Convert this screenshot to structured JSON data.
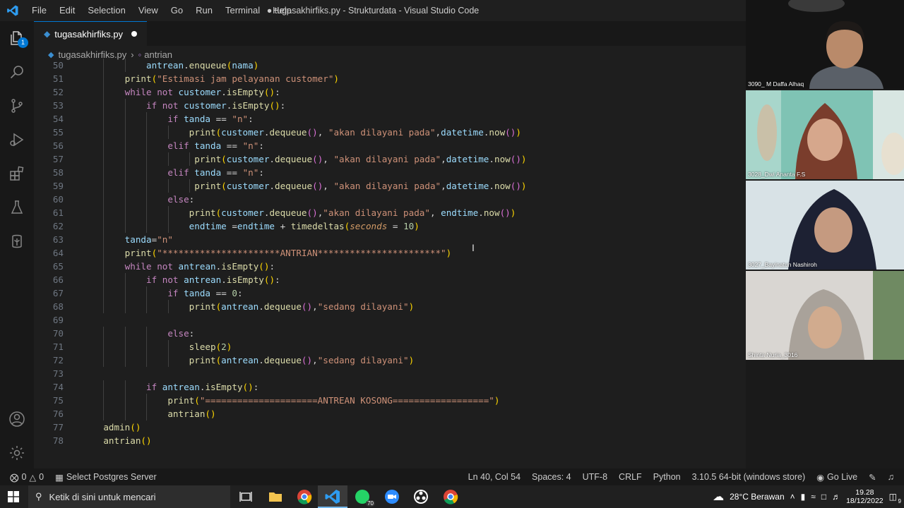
{
  "titlebar": {
    "menu": [
      "File",
      "Edit",
      "Selection",
      "View",
      "Go",
      "Run",
      "Terminal",
      "Help"
    ],
    "window_title": "● tugasakhirfiks.py - Strukturdata - Visual Studio Code"
  },
  "activity": {
    "icons": [
      "explorer-icon",
      "search-icon",
      "source-control-icon",
      "run-debug-icon",
      "extensions-icon",
      "testing-icon",
      "database-icon",
      "account-icon",
      "settings-gear-icon"
    ],
    "explorer_badge": "1"
  },
  "editor": {
    "tab_label": "tugasakhirfiks.py",
    "breadcrumb": {
      "file": "tugasakhirfiks.py",
      "symbol": "antrian"
    },
    "lines": [
      {
        "n": "50",
        "t": "            antrean.enqueue(nama)"
      },
      {
        "n": "51",
        "t": "        print(\"Estimasi jam pelayanan customer\")"
      },
      {
        "n": "52",
        "t": "        while not customer.isEmpty():"
      },
      {
        "n": "53",
        "t": "            if not customer.isEmpty():"
      },
      {
        "n": "54",
        "t": "                if tanda == \"n\":"
      },
      {
        "n": "55",
        "t": "                    print(customer.dequeue(), \"akan dilayani pada\",datetime.now())"
      },
      {
        "n": "56",
        "t": "                elif tanda == \"n\":"
      },
      {
        "n": "57",
        "t": "                     print(customer.dequeue(), \"akan dilayani pada\",datetime.now())"
      },
      {
        "n": "58",
        "t": "                elif tanda == \"n\":"
      },
      {
        "n": "59",
        "t": "                     print(customer.dequeue(), \"akan dilayani pada\",datetime.now())"
      },
      {
        "n": "60",
        "t": "                else:"
      },
      {
        "n": "61",
        "t": "                    print(customer.dequeue(),\"akan dilayani pada\", endtime.now())"
      },
      {
        "n": "62",
        "t": "                    endtime =endtime + timedeltas(seconds = 10)"
      },
      {
        "n": "63",
        "t": "        tanda=\"n\""
      },
      {
        "n": "64",
        "t": "        print(\"**********************ANTRIAN***********************\")"
      },
      {
        "n": "65",
        "t": "        while not antrean.isEmpty():"
      },
      {
        "n": "66",
        "t": "            if not antrean.isEmpty():"
      },
      {
        "n": "67",
        "t": "                if tanda == 0:"
      },
      {
        "n": "68",
        "t": "                    print(antrean.dequeue(),\"sedang dilayani\")"
      },
      {
        "n": "69",
        "t": ""
      },
      {
        "n": "70",
        "t": "                else:"
      },
      {
        "n": "71",
        "t": "                    sleep(2)"
      },
      {
        "n": "72",
        "t": "                    print(antrean.dequeue(),\"sedang dilayani\")"
      },
      {
        "n": "73",
        "t": ""
      },
      {
        "n": "74",
        "t": "            if antrean.isEmpty():"
      },
      {
        "n": "75",
        "t": "                print(\"=====================ANTREAN KOSONG==================\")"
      },
      {
        "n": "76",
        "t": "                antrian()"
      },
      {
        "n": "77",
        "t": "    admin()"
      },
      {
        "n": "78",
        "t": "    antrian()"
      }
    ]
  },
  "statusbar": {
    "problems": "0",
    "warnings": "0",
    "postgres": "Select Postgres Server",
    "position": "Ln 40, Col 54",
    "spaces": "Spaces: 4",
    "encoding": "UTF-8",
    "eol": "CRLF",
    "language": "Python",
    "interpreter": "3.10.5 64-bit (windows store)",
    "golive": "Go Live"
  },
  "participants": [
    {
      "name": "3090_ M Daffa Alhaq"
    },
    {
      "name": "3028_Dwi Ananta F.S"
    },
    {
      "name": "3027_Bayinatun Nashiroh"
    },
    {
      "name": "Shinta Nuria_3016"
    }
  ],
  "taskbar": {
    "search_placeholder": "Ketik di sini untuk mencari",
    "whatsapp_badge": "70",
    "weather": "28°C  Berawan",
    "time": "19.28",
    "date": "18/12/2022",
    "notif_count": "9"
  }
}
